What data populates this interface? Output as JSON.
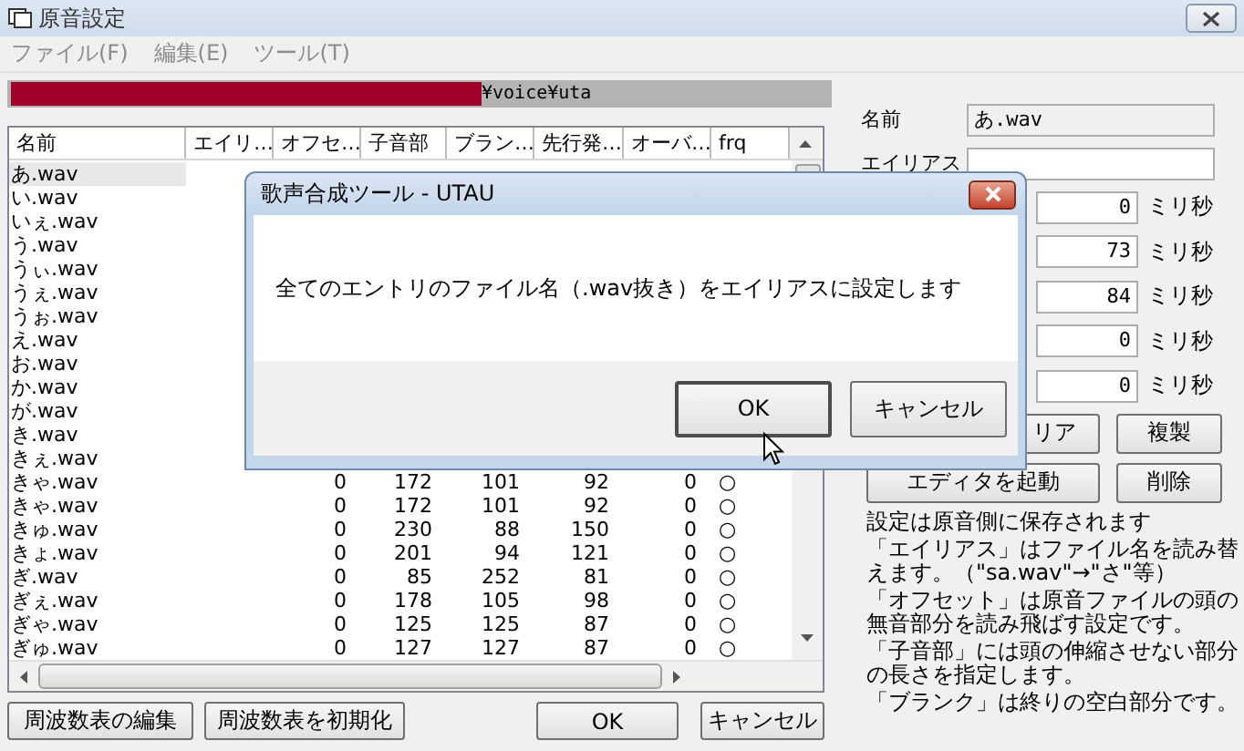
{
  "window": {
    "title": "原音設定"
  },
  "menu": [
    {
      "label": "ファイル(F)",
      "disabled": true
    },
    {
      "label": "編集(E)",
      "disabled": true
    },
    {
      "label": "ツール(T)",
      "disabled": true
    }
  ],
  "path": "¥voice¥uta",
  "table": {
    "columns": [
      "名前",
      "エイリ…",
      "オフセ…",
      "子音部",
      "ブラン…",
      "先行発…",
      "オーバ…",
      "frq"
    ],
    "rows": [
      {
        "name": "あ.wav",
        "selected": true
      },
      {
        "name": "い.wav",
        "selected": false
      },
      {
        "name": "いぇ.wav",
        "selected": false
      },
      {
        "name": "う.wav",
        "selected": false
      },
      {
        "name": "うぃ.wav",
        "selected": false
      },
      {
        "name": "うぇ.wav",
        "selected": false
      },
      {
        "name": "うぉ.wav",
        "selected": false
      },
      {
        "name": "え.wav",
        "selected": false
      },
      {
        "name": "お.wav",
        "selected": false
      },
      {
        "name": "か.wav",
        "selected": false
      },
      {
        "name": "が.wav",
        "selected": false
      },
      {
        "name": "き.wav",
        "selected": false
      },
      {
        "name": "きぇ.wav",
        "selected": false
      },
      {
        "name": "きゃ.wav",
        "selected": false,
        "values": [
          "0",
          "172",
          "101",
          "92",
          "0",
          "○"
        ]
      },
      {
        "name": "きゃ.wav",
        "selected": false,
        "values": [
          "0",
          "172",
          "101",
          "92",
          "0",
          "○"
        ]
      },
      {
        "name": "きゅ.wav",
        "selected": false,
        "values": [
          "0",
          "230",
          "88",
          "150",
          "0",
          "○"
        ]
      },
      {
        "name": "きょ.wav",
        "selected": false,
        "values": [
          "0",
          "201",
          "94",
          "121",
          "0",
          "○"
        ]
      },
      {
        "name": "ぎ.wav",
        "selected": false,
        "values": [
          "0",
          "85",
          "252",
          "81",
          "0",
          "○"
        ]
      },
      {
        "name": "ぎぇ.wav",
        "selected": false,
        "values": [
          "0",
          "178",
          "105",
          "98",
          "0",
          "○"
        ]
      },
      {
        "name": "ぎゃ.wav",
        "selected": false,
        "values": [
          "0",
          "125",
          "125",
          "87",
          "0",
          "○"
        ]
      },
      {
        "name": "ぎゅ.wav",
        "selected": false,
        "values": [
          "0",
          "127",
          "127",
          "87",
          "0",
          "○"
        ]
      }
    ]
  },
  "bottom_buttons": [
    "周波数表の編集",
    "周波数表を初期化",
    "OK",
    "キャンセル"
  ],
  "details": {
    "name_label": "名前",
    "name_value": "あ.wav",
    "alias_label": "エイリアス",
    "params": [
      {
        "value": "0",
        "unit": "ミリ秒"
      },
      {
        "value": "73",
        "unit": "ミリ秒"
      },
      {
        "value": "84",
        "unit": "ミリ秒"
      },
      {
        "value": "0",
        "unit": "ミリ秒"
      },
      {
        "value": "0",
        "unit": "ミリ秒"
      }
    ],
    "buttons": [
      "リア",
      "複製",
      "エディタを起動",
      "削除"
    ],
    "notes": [
      "設定は原音側に保存されます",
      "「エイリアス」はファイル名を読み替えます。（\"sa.wav\"→\"さ\"等）",
      "「オフセット」は原音ファイルの頭の無音部分を読み飛ばす設定です。",
      "「子音部」には頭の伸縮させない部分の長さを指定します。",
      "「ブランク」は終りの空白部分です。"
    ]
  },
  "dialog": {
    "title": "歌声合成ツール - UTAU",
    "message": "全てのエントリのファイル名（.wav抜き）をエイリアスに設定します",
    "buttons": [
      "OK",
      "キャンセル"
    ]
  }
}
